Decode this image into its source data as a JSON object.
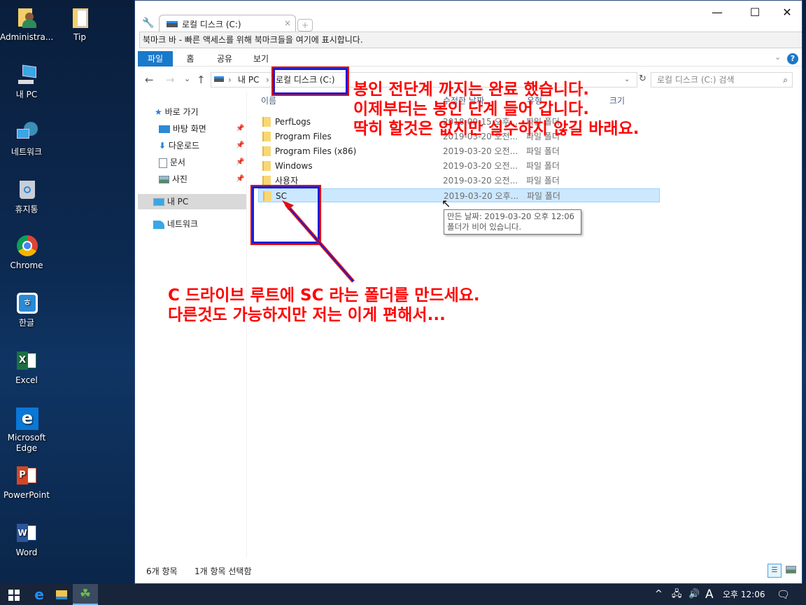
{
  "desktop": {
    "icons": [
      {
        "label": "Administra...",
        "icon": "user-folder-icon"
      },
      {
        "label": "Tip",
        "icon": "folder-icon"
      },
      {
        "label": "내 PC",
        "icon": "computer-icon"
      },
      {
        "label": "네트워크",
        "icon": "network-icon"
      },
      {
        "label": "휴지통",
        "icon": "recycle-bin-icon"
      },
      {
        "label": "Chrome",
        "icon": "chrome-icon"
      },
      {
        "label": "한글",
        "icon": "hangul-icon"
      },
      {
        "label": "Excel",
        "icon": "excel-icon"
      },
      {
        "label": "Microsoft Edge",
        "icon": "edge-icon"
      },
      {
        "label": "PowerPoint",
        "icon": "powerpoint-icon"
      },
      {
        "label": "Word",
        "icon": "word-icon"
      }
    ]
  },
  "window": {
    "tab_title": "로컬 디스크 (C:)",
    "tab_close": "×",
    "new_tab": "+",
    "controls": {
      "minimize": "—",
      "maximize": "☐",
      "close": "✕"
    },
    "bookmark_bar": "북마크 바 - 빠른 액세스를 위해 북마크들을 여기에 표시합니다."
  },
  "ribbon": {
    "tabs": [
      "파일",
      "홈",
      "공유",
      "보기"
    ],
    "help": "?"
  },
  "navigation": {
    "back": "←",
    "forward": "→",
    "recent": "⌄",
    "up": "↑",
    "breadcrumb": [
      "내 PC",
      "로컬 디스크 (C:)"
    ],
    "separator": "›",
    "refresh": "↻",
    "search_placeholder": "로컬 디스크 (C:) 검색"
  },
  "nav_pane": {
    "quick_access": "바로 가기",
    "pinned": [
      {
        "label": "바탕 화면",
        "icon": "desktop-icon"
      },
      {
        "label": "다운로드",
        "icon": "download-icon"
      },
      {
        "label": "문서",
        "icon": "document-icon"
      },
      {
        "label": "사진",
        "icon": "picture-icon"
      }
    ],
    "this_pc": "내 PC",
    "network": "네트워크"
  },
  "file_list": {
    "columns": [
      "이름",
      "수정한 날짜",
      "유형",
      "크기"
    ],
    "rows": [
      {
        "name": "PerfLogs",
        "date": "2018-09-15 오후...",
        "type": "파일 폴더",
        "selected": false
      },
      {
        "name": "Program Files",
        "date": "2019-03-20 오전...",
        "type": "파일 폴더",
        "selected": false
      },
      {
        "name": "Program Files (x86)",
        "date": "2019-03-20 오전...",
        "type": "파일 폴더",
        "selected": false
      },
      {
        "name": "Windows",
        "date": "2019-03-20 오전...",
        "type": "파일 폴더",
        "selected": false
      },
      {
        "name": "사용자",
        "date": "2019-03-20 오전...",
        "type": "파일 폴더",
        "selected": false
      },
      {
        "name": "SC",
        "date": "2019-03-20 오후...",
        "type": "파일 폴더",
        "selected": true
      }
    ],
    "tooltip": {
      "line1": "만든 날짜: 2019-03-20 오후 12:06",
      "line2": "폴더가 비어 있습니다."
    }
  },
  "status_bar": {
    "item_count": "6개 항목",
    "selected_count": "1개 항목 선택함"
  },
  "annotations": {
    "top": [
      "봉인 전단계 까지는 완료 했습니다.",
      "이제부터는 봉인 단계 들어 갑니다.",
      "딱히 할것은 없지만 실수하지 않길 바래요."
    ],
    "bottom": [
      "C 드라이브 루트에 SC 라는 폴더를 만드세요.",
      "다른것도 가능하지만 저는 이게 편해서..."
    ],
    "color": "#ff0000",
    "box_color": "#1b1bd6"
  },
  "taskbar": {
    "start": "start-icon",
    "pinned": [
      "edge-icon",
      "file-explorer-icon",
      "clover-app-icon"
    ],
    "tray": {
      "chevron": "^",
      "ime": "A",
      "time": "오후 12:06"
    }
  }
}
